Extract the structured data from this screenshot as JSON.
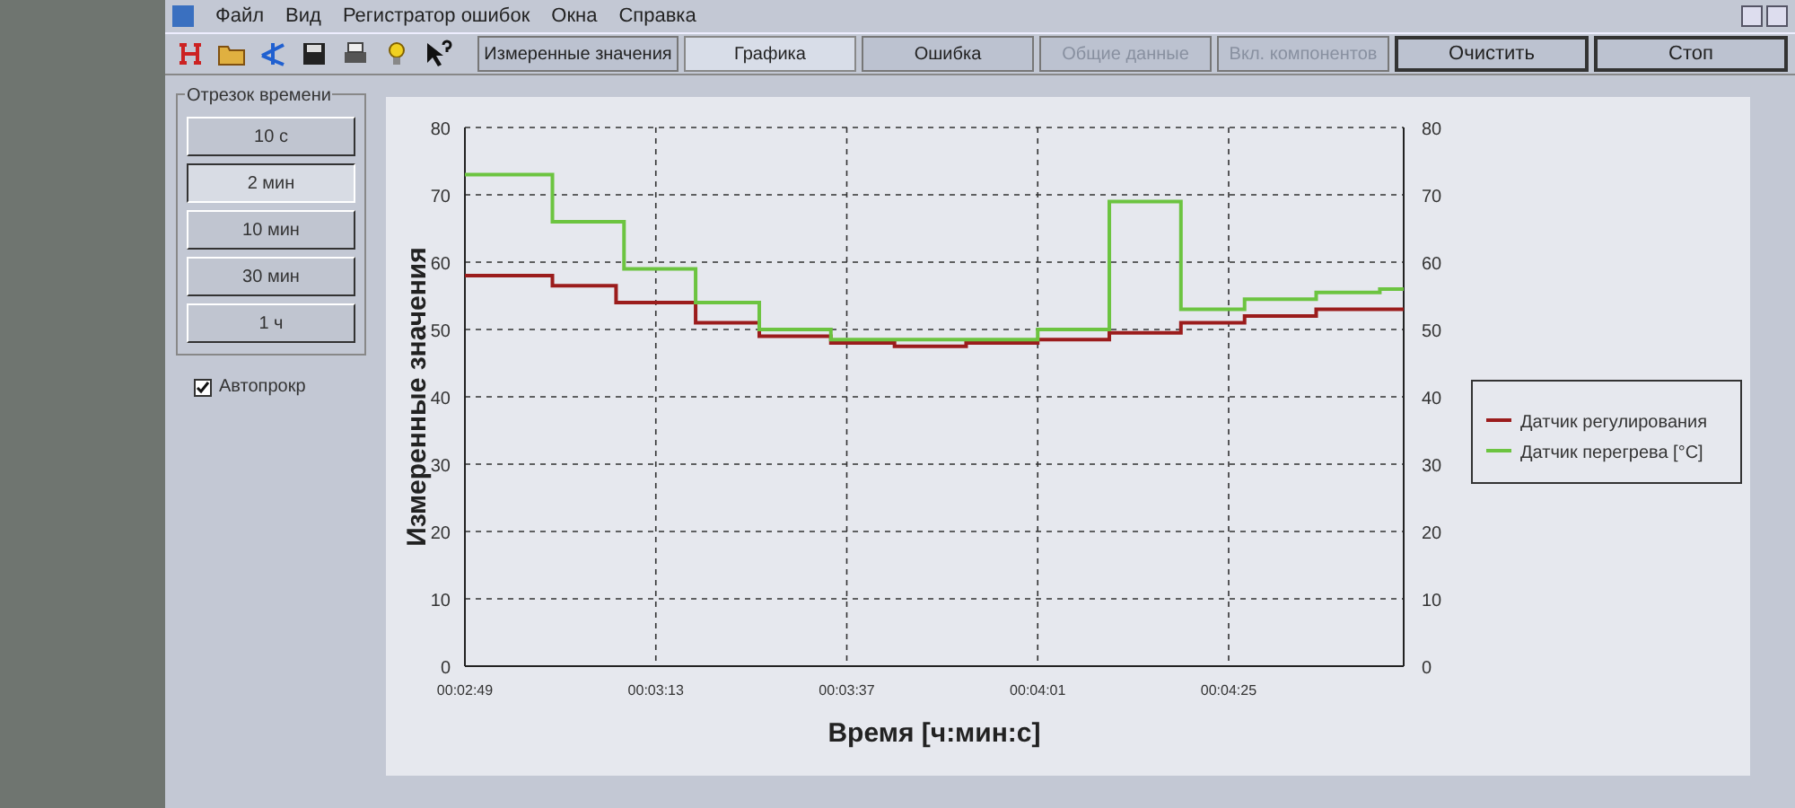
{
  "menu": [
    "Файл",
    "Вид",
    "Регистратор ошибок",
    "Окна",
    "Справка"
  ],
  "tabs": [
    {
      "label": "Измеренные значения",
      "selected": false,
      "disabled": false
    },
    {
      "label": "Графика",
      "selected": true,
      "disabled": false
    },
    {
      "label": "Ошибка",
      "selected": false,
      "disabled": false
    },
    {
      "label": "Общие данные",
      "selected": false,
      "disabled": true
    },
    {
      "label": "Вкл. компонентов",
      "selected": false,
      "disabled": true
    }
  ],
  "actions": [
    "Очистить",
    "Стоп"
  ],
  "time_range": {
    "title": "Отрезок времени",
    "options": [
      {
        "label": "10 с",
        "selected": false
      },
      {
        "label": "2 мин",
        "selected": true
      },
      {
        "label": "10 мин",
        "selected": false
      },
      {
        "label": "30 мин",
        "selected": false
      },
      {
        "label": "1 ч",
        "selected": false
      }
    ]
  },
  "autoscroll": {
    "label": "Автопрокр",
    "checked": true
  },
  "chart": {
    "chart_data": {
      "type": "line",
      "xlabel": "Время [ч:мин:с]",
      "ylabel": "Измеренные значения",
      "x": [
        169,
        180,
        180,
        188,
        188,
        189,
        189,
        198,
        198,
        206,
        206,
        215,
        215,
        223,
        223,
        232,
        232,
        241,
        241,
        250,
        250,
        259,
        259,
        267,
        267,
        276,
        276,
        284,
        284,
        287
      ],
      "series": [
        {
          "name": "Датчик регулирования",
          "color": "#9b1c1c",
          "values": [
            58,
            58,
            56.5,
            56.5,
            54,
            54,
            54,
            54,
            51,
            51,
            49,
            49,
            48,
            48,
            47.5,
            47.5,
            48,
            48,
            48.5,
            48.5,
            49.5,
            49.5,
            51,
            51,
            52,
            52,
            53,
            53,
            53,
            53
          ]
        },
        {
          "name": "Датчик перегрева [°C]",
          "color": "#6cc440",
          "values": [
            73,
            73,
            66,
            66,
            66,
            66,
            59,
            59,
            54,
            54,
            50,
            50,
            48.5,
            48.5,
            48.5,
            48.5,
            48.5,
            48.5,
            50,
            50,
            69,
            69,
            53,
            53,
            54.5,
            54.5,
            55.5,
            55.5,
            56,
            56
          ]
        }
      ],
      "grid": true,
      "legend": true,
      "xlim": [
        169,
        287
      ],
      "ylim": [
        0,
        80
      ],
      "xticks": [
        {
          "value": 169,
          "label": "00:02:49"
        },
        {
          "value": 193,
          "label": "00:03:13"
        },
        {
          "value": 217,
          "label": "00:03:37"
        },
        {
          "value": 241,
          "label": "00:04:01"
        },
        {
          "value": 265,
          "label": "00:04:25"
        }
      ],
      "yticks": [
        {
          "value": 0,
          "label": "0"
        },
        {
          "value": 10,
          "label": "10"
        },
        {
          "value": 20,
          "label": "20"
        },
        {
          "value": 30,
          "label": "30"
        },
        {
          "value": 40,
          "label": "40"
        },
        {
          "value": 50,
          "label": "50"
        },
        {
          "value": 60,
          "label": "60"
        },
        {
          "value": 70,
          "label": "70"
        },
        {
          "value": 80,
          "label": "80"
        }
      ]
    },
    "right_axis_ticks": [
      "80",
      "70",
      "60",
      "50",
      "40",
      "30",
      "20",
      "10",
      "0"
    ]
  }
}
